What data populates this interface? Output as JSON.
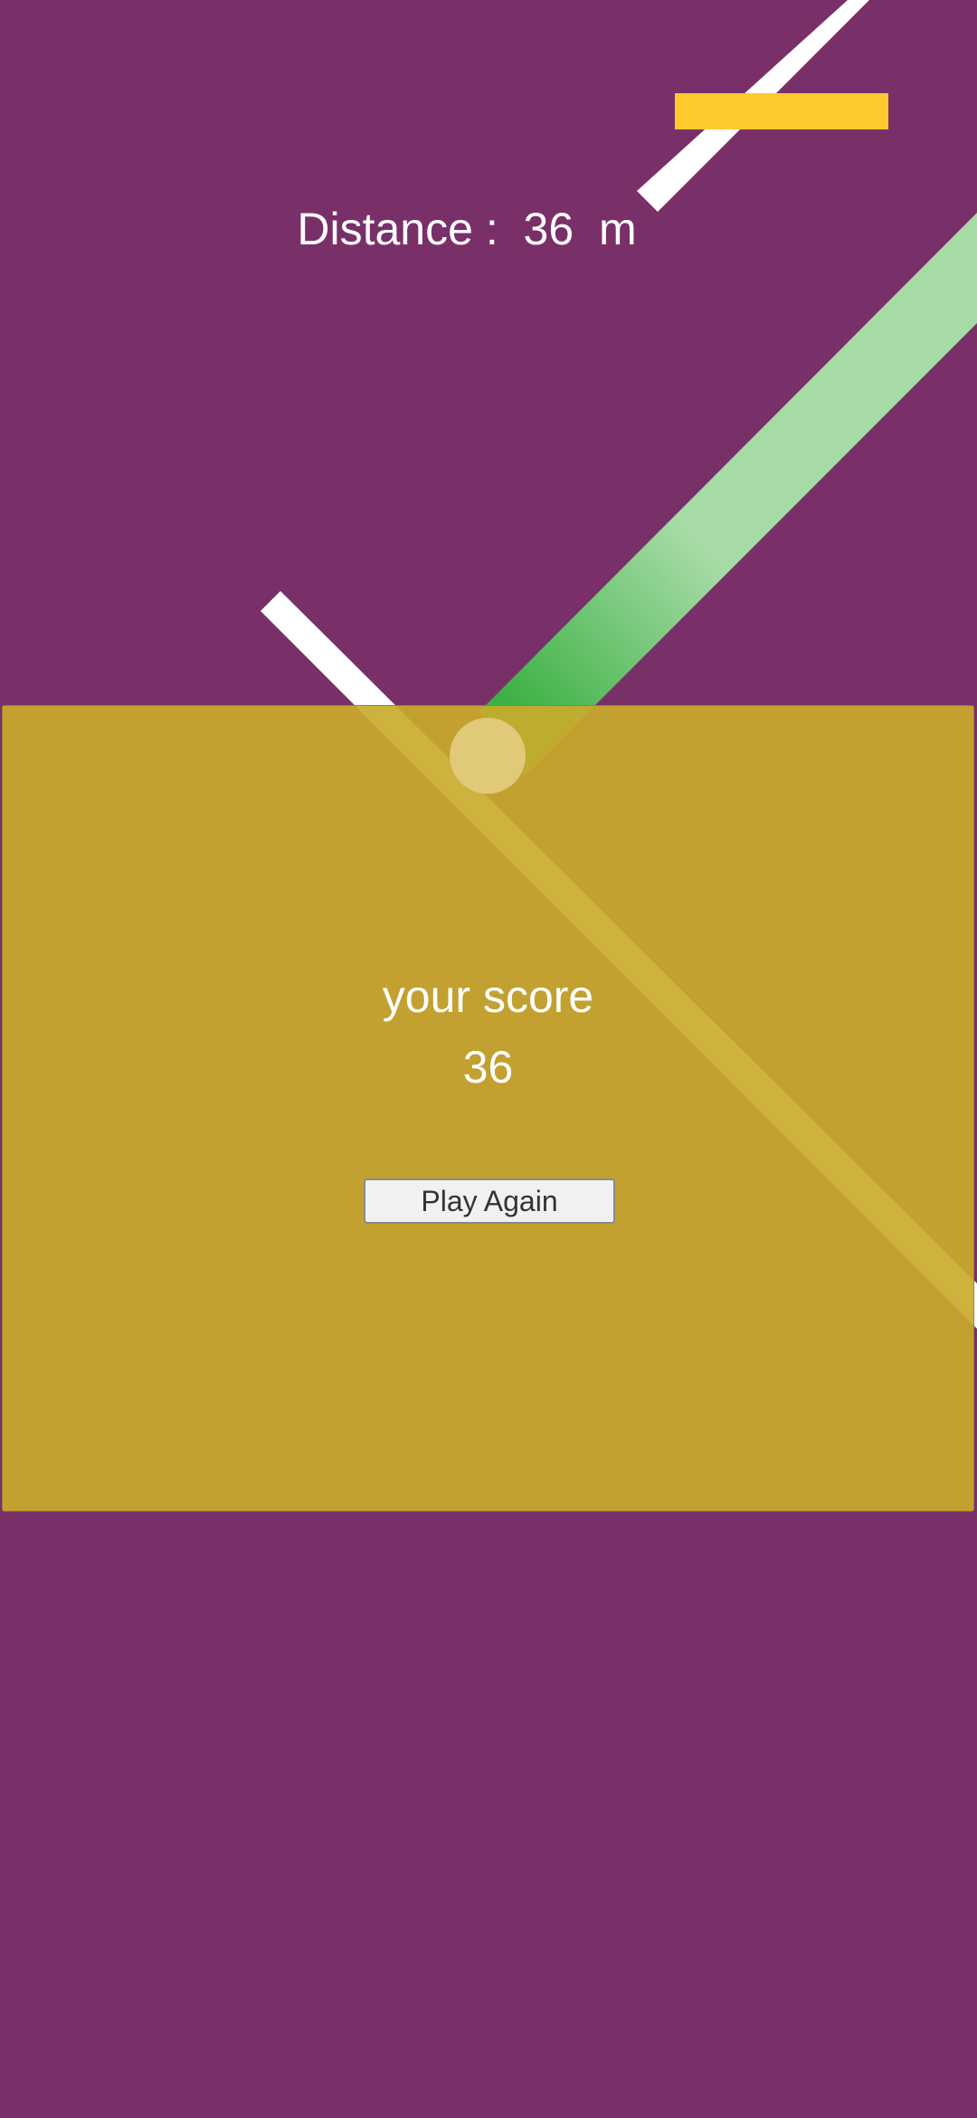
{
  "hud": {
    "distance_label": "Distance :",
    "distance_value": "36",
    "distance_unit": "m"
  },
  "game_over": {
    "score_label": "your score",
    "score_value": "36",
    "play_again_label": "Play Again"
  },
  "colors": {
    "background": "#793068",
    "panel": "#c9ab2c",
    "score_bar": "#ffca2e",
    "beam": "#ffffff",
    "trail_start": "#3cb043",
    "trail_end": "#a6dba6",
    "ball": "#e0c978"
  }
}
